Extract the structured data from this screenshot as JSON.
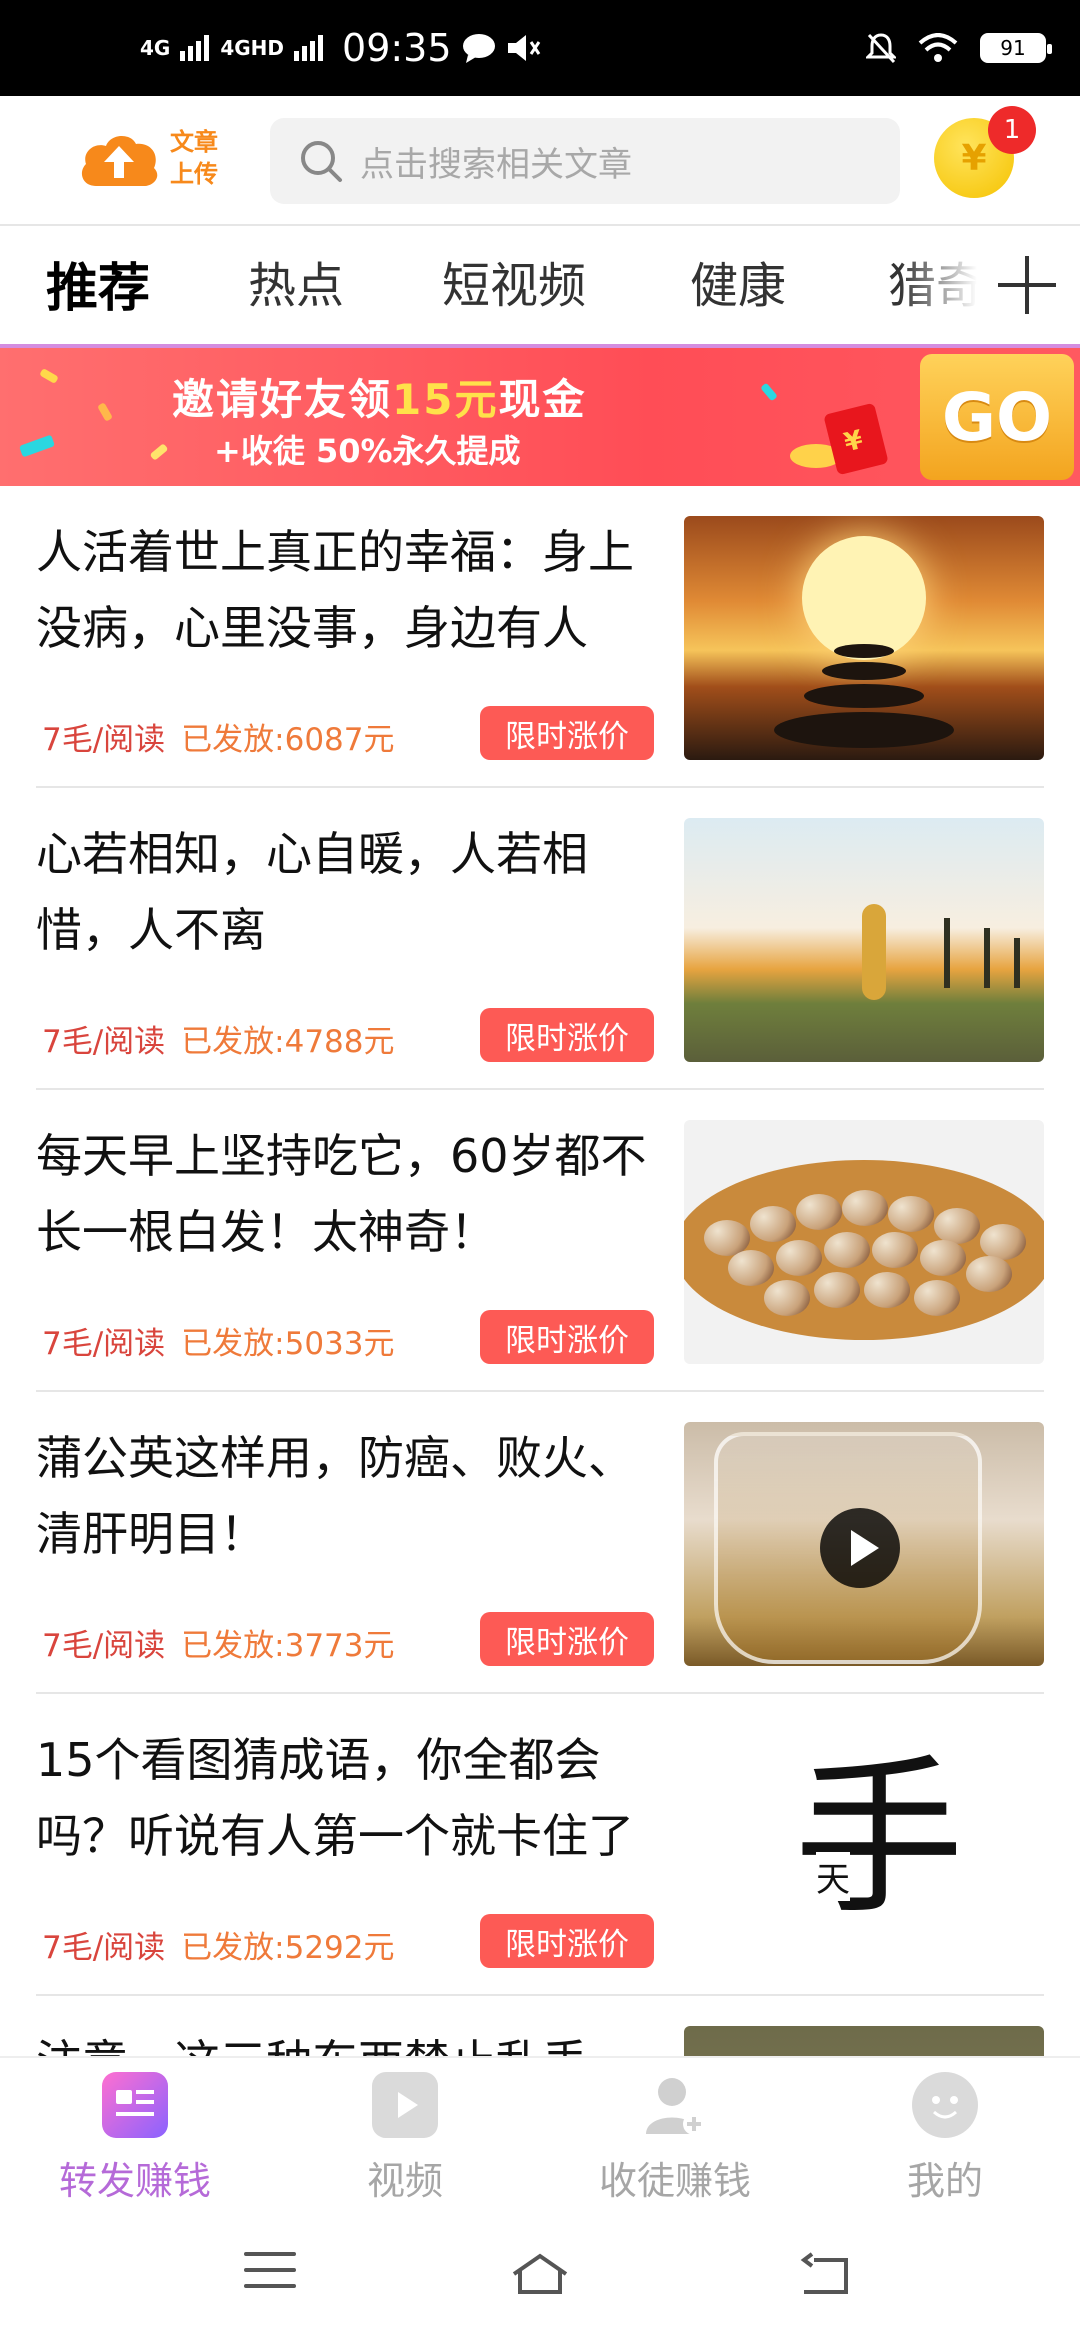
{
  "status_bar": {
    "signal1": "4G",
    "signal2": "4GHD",
    "time": "09:35",
    "battery": "91"
  },
  "header": {
    "logo_text_line1": "文章",
    "logo_text_line2": "上传",
    "search_placeholder": "点击搜索相关文章",
    "coin_symbol": "¥",
    "coin_badge": "1"
  },
  "tabs": [
    {
      "label": "推荐",
      "active": true
    },
    {
      "label": "热点"
    },
    {
      "label": "短视频"
    },
    {
      "label": "健康"
    },
    {
      "label": "猎奇"
    }
  ],
  "banner": {
    "line1_pre": "邀请好友领",
    "line1_highlight": "15元",
    "line1_post": "现金",
    "line2": "+收徒 50%永久提成",
    "go": "GO"
  },
  "articles": [
    {
      "title": "人活着世上真正的幸福：身上没病，心里没事，身边有人",
      "price": "7毛/阅读",
      "paid": "已发放:6087元",
      "tag": "限时涨价"
    },
    {
      "title": "心若相知，心自暖，人若相惜，人不离",
      "price": "7毛/阅读",
      "paid": "已发放:4788元",
      "tag": "限时涨价"
    },
    {
      "title": "每天早上坚持吃它，60岁都不长一根白发！太神奇！",
      "price": "7毛/阅读",
      "paid": "已发放:5033元",
      "tag": "限时涨价"
    },
    {
      "title": "蒲公英这样用，防癌、败火、清肝明目！",
      "price": "7毛/阅读",
      "paid": "已发放:3773元",
      "tag": "限时涨价"
    },
    {
      "title": "15个看图猜成语，你全都会吗？听说有人第一个就卡住了",
      "price": "7毛/阅读",
      "paid": "已发放:5292元",
      "tag": "限时涨价",
      "thumb_big": "手",
      "thumb_small": "天"
    },
    {
      "title": "注意，这三种东西禁止乱丢"
    }
  ],
  "bottom_nav": [
    {
      "label": "转发赚钱",
      "icon": "article-icon",
      "active": true
    },
    {
      "label": "视频",
      "icon": "video-icon"
    },
    {
      "label": "收徒赚钱",
      "icon": "add-user-icon"
    },
    {
      "label": "我的",
      "icon": "profile-icon"
    }
  ],
  "colors": {
    "accent": "#b56ad8",
    "tag_bg": "#fd5a55",
    "price_text": "#d9453d",
    "paid_text": "#ef7a3a",
    "banner_bg": "#ff4d56",
    "logo_orange": "#f7891b"
  }
}
